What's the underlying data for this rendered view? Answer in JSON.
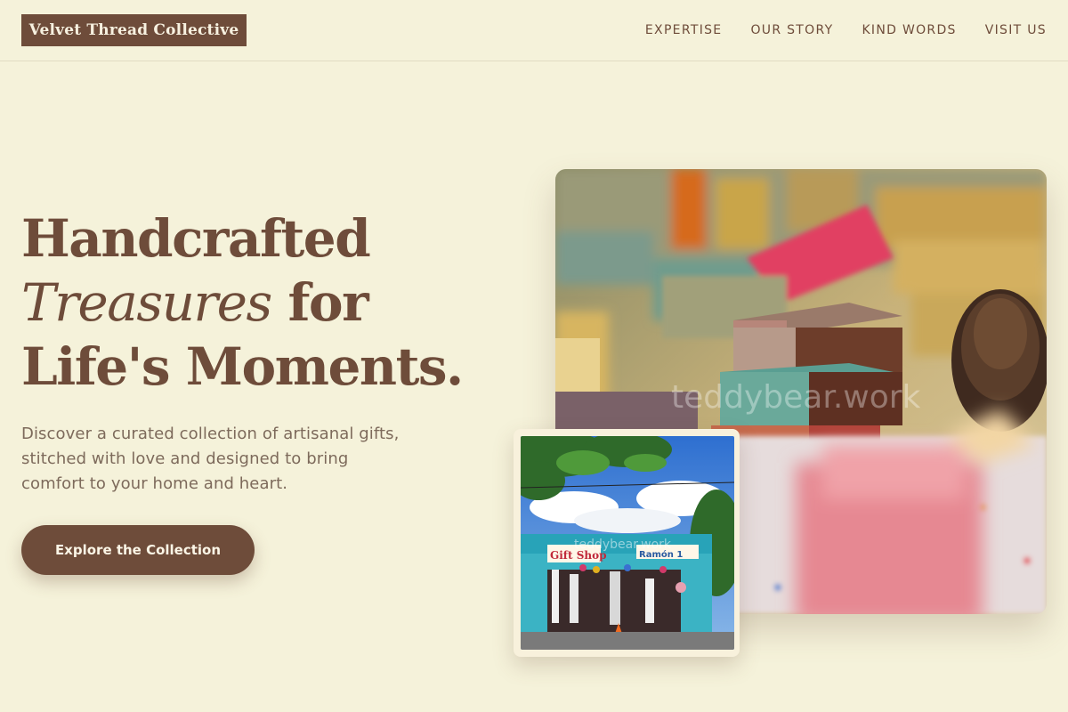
{
  "brand": {
    "name": "Velvet Thread Collective"
  },
  "nav": {
    "items": [
      {
        "label": "EXPERTISE"
      },
      {
        "label": "OUR STORY"
      },
      {
        "label": "KIND WORDS"
      },
      {
        "label": "VISIT US"
      }
    ]
  },
  "hero": {
    "headline_line1": "Handcrafted",
    "headline_italic": "Treasures",
    "headline_for": " for",
    "headline_line3": "Life's Moments.",
    "subtitle": "Discover a curated collection of artisanal gifts, stitched with love and designed to bring comfort to your home and heart.",
    "cta_label": "Explore the Collection",
    "main_image_watermark": "teddybear.work",
    "small_image_watermark": "teddybear.work",
    "shop_sign_left": "Gift Shop",
    "shop_sign_right": "Ramón 1"
  },
  "colors": {
    "background": "#f5f2da",
    "brand_brown": "#6e4c3a",
    "body_text": "#7d6a5b"
  },
  "icons": {
    "main_image": "handmade-soap-gift-boxes-photo",
    "small_image": "gift-shop-storefront-photo"
  }
}
